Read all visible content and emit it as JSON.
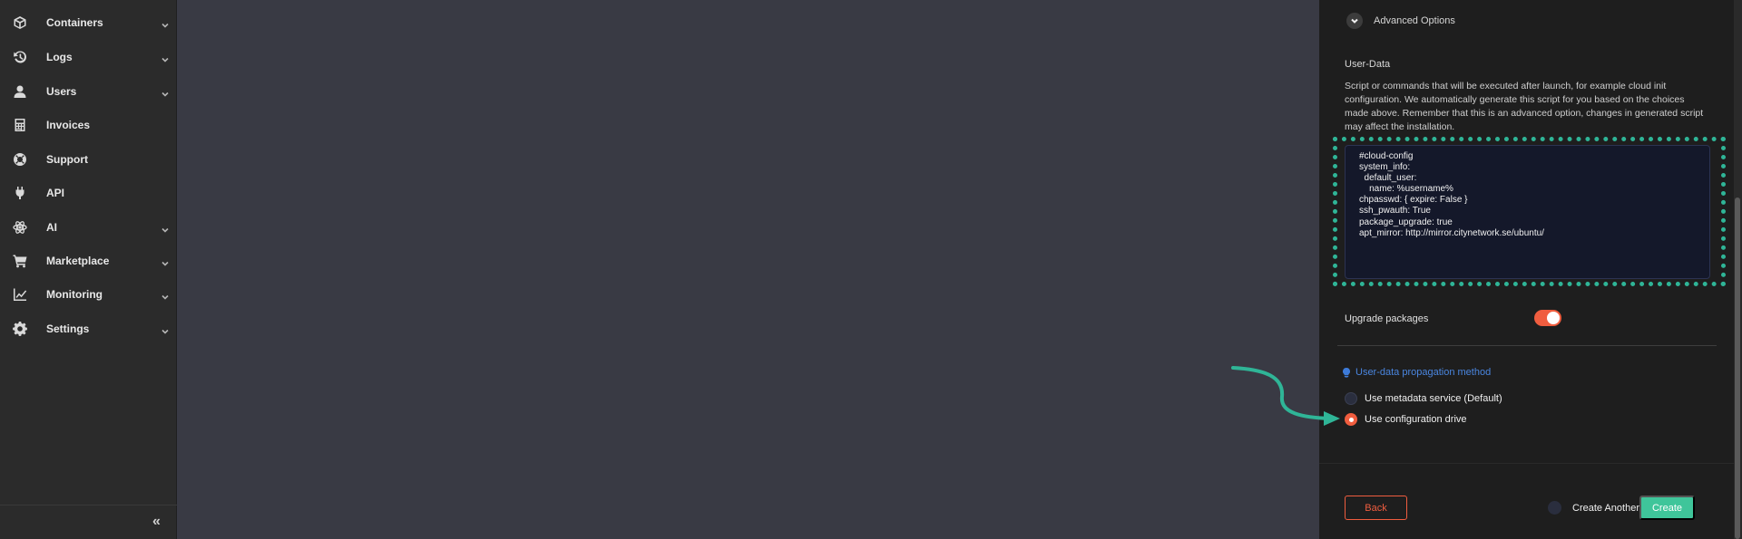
{
  "sidebar": {
    "items": [
      {
        "label": "Containers",
        "icon": "cube-icon",
        "has_chevron": true
      },
      {
        "label": "Logs",
        "icon": "history-icon",
        "has_chevron": true
      },
      {
        "label": "Users",
        "icon": "user-icon",
        "has_chevron": true
      },
      {
        "label": "Invoices",
        "icon": "calculator-icon",
        "has_chevron": false
      },
      {
        "label": "Support",
        "icon": "lifebuoy-icon",
        "has_chevron": false
      },
      {
        "label": "API",
        "icon": "plug-icon",
        "has_chevron": false
      },
      {
        "label": "AI",
        "icon": "atom-icon",
        "has_chevron": true
      },
      {
        "label": "Marketplace",
        "icon": "cart-icon",
        "has_chevron": true
      },
      {
        "label": "Monitoring",
        "icon": "chart-line-icon",
        "has_chevron": true
      },
      {
        "label": "Settings",
        "icon": "gear-icon",
        "has_chevron": true
      }
    ],
    "collapse_glyph": "«"
  },
  "panel": {
    "advanced_options_label": "Advanced Options",
    "user_data": {
      "title": "User-Data",
      "description": "Script or commands that will be executed after launch, for example cloud init configuration. We automatically generate this script for you based on the choices made above. Remember that this is an advanced option, changes in generated script may affect the installation.",
      "script": "#cloud-config\nsystem_info:\n  default_user:\n    name: %username%\nchpasswd: { expire: False }\nssh_pwauth: True\npackage_upgrade: true\napt_mirror: http://mirror.citynetwork.se/ubuntu/"
    },
    "upgrade_packages": {
      "label": "Upgrade packages",
      "enabled": true
    },
    "propagation": {
      "hint": "User-data propagation method",
      "options": [
        {
          "label": "Use metadata service (Default)",
          "checked": false
        },
        {
          "label": "Use configuration drive",
          "checked": true
        }
      ]
    },
    "footer": {
      "back_label": "Back",
      "create_another_label": "Create Another",
      "create_label": "Create"
    }
  },
  "colors": {
    "accent_orange": "#f05d3f",
    "accent_green": "#3fc59a",
    "annotation_teal": "#2fb597",
    "link_blue": "#4a86e0"
  }
}
